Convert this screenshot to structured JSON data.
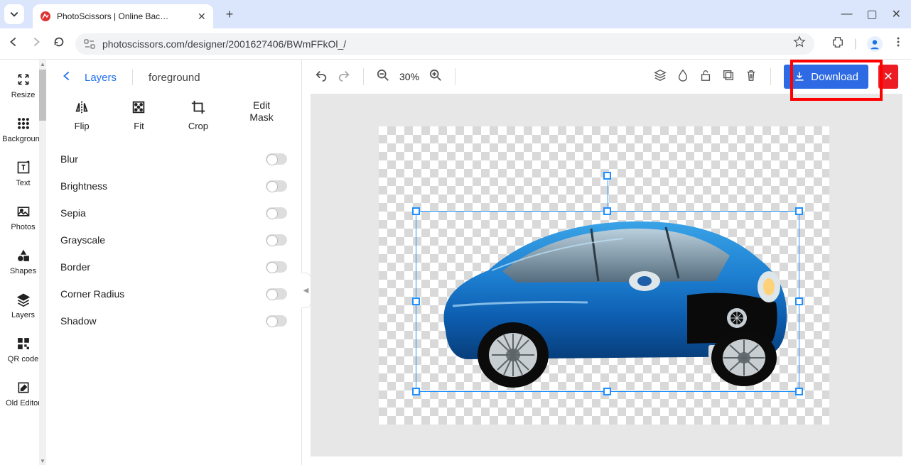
{
  "browser": {
    "tab_title": "PhotoScissors | Online Backgro",
    "url": "photoscissors.com/designer/2001627406/BWmFFkOl_/"
  },
  "left_rail": [
    {
      "id": "resize",
      "label": "Resize"
    },
    {
      "id": "background",
      "label": "Background"
    },
    {
      "id": "text",
      "label": "Text"
    },
    {
      "id": "photos",
      "label": "Photos"
    },
    {
      "id": "shapes",
      "label": "Shapes"
    },
    {
      "id": "layers",
      "label": "Layers"
    },
    {
      "id": "qrcode",
      "label": "QR code"
    },
    {
      "id": "oldeditor",
      "label": "Old Editor"
    }
  ],
  "panel": {
    "back_label": "Layers",
    "title": "foreground",
    "tools": {
      "flip": "Flip",
      "fit": "Fit",
      "crop": "Crop",
      "edit_mask": "Edit\nMask"
    },
    "props": [
      {
        "label": "Blur"
      },
      {
        "label": "Brightness"
      },
      {
        "label": "Sepia"
      },
      {
        "label": "Grayscale"
      },
      {
        "label": "Border"
      },
      {
        "label": "Corner Radius"
      },
      {
        "label": "Shadow"
      }
    ]
  },
  "toolbar": {
    "zoom": "30%",
    "download": "Download"
  }
}
